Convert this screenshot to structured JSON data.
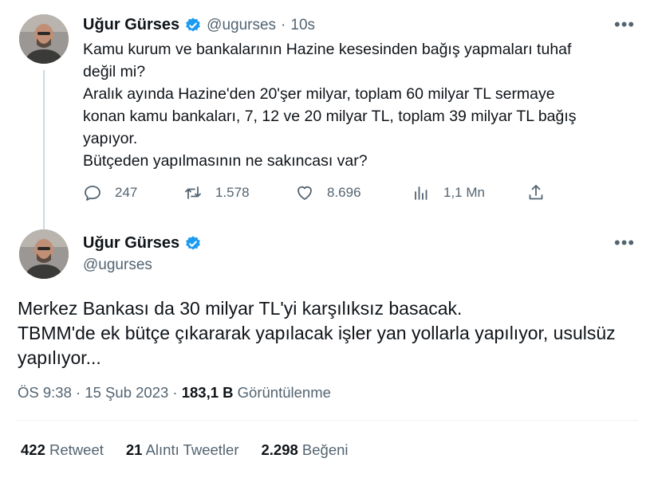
{
  "quoted_tweet": {
    "author_name": "Uğur Gürses",
    "handle": "@ugurses",
    "separator": "·",
    "time": "10s",
    "lines": [
      "Kamu kurum ve bankalarının Hazine kesesinden bağış yapmaları tuhaf",
      "değil mi?",
      "Aralık ayında Hazine'den 20'şer milyar, toplam 60 milyar TL sermaye",
      "konan kamu bankaları, 7, 12 ve 20 milyar TL, toplam 39 milyar TL bağış",
      "yapıyor.",
      "Bütçeden yapılmasının ne sakıncası var?"
    ],
    "actions": {
      "replies": "247",
      "retweets": "1.578",
      "likes": "8.696",
      "views": "1,1 Mn"
    }
  },
  "main_tweet": {
    "author_name": "Uğur Gürses",
    "handle": "@ugurses",
    "lines": [
      "Merkez Bankası da 30 milyar TL'yi karşılıksız basacak.",
      "TBMM'de ek bütçe çıkararak yapılacak işler yan yollarla yapılıyor, usulsüz",
      "yapılıyor..."
    ],
    "time": "ÖS 9:38",
    "date": "15 Şub 2023",
    "views_count": "183,1 B",
    "views_label": "Görüntülenme",
    "stats": {
      "retweet_count": "422",
      "retweet_label": "Retweet",
      "quote_count": "21",
      "quote_label": "Alıntı Tweetler",
      "like_count": "2.298",
      "like_label": "Beğeni"
    }
  },
  "colors": {
    "verified": "#1d9bf0",
    "text": "#0f1419",
    "secondary": "#536471",
    "divider": "#eff3f4"
  },
  "icons": [
    "reply-icon",
    "retweet-icon",
    "like-icon",
    "views-icon",
    "share-icon",
    "verified-icon",
    "more-icon"
  ]
}
